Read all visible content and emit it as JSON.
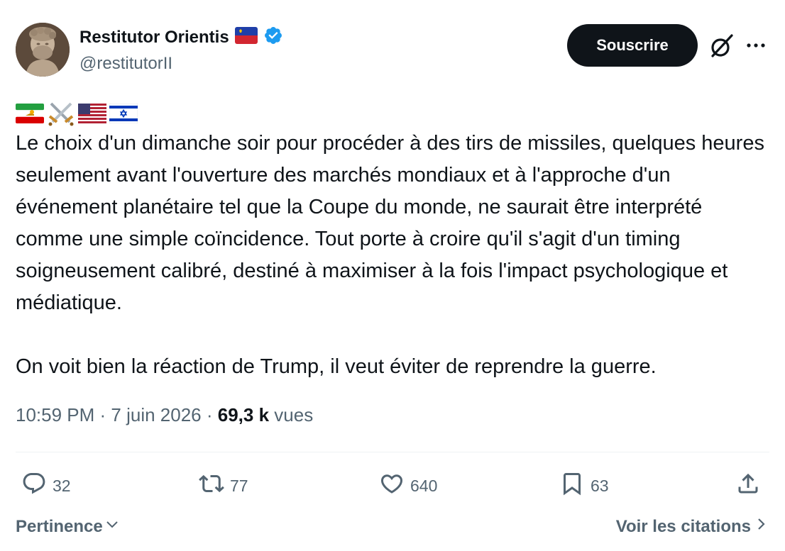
{
  "author": {
    "display_name": "Restitutor Orientis",
    "handle": "@restitutorII",
    "badge_flag": "liechtenstein-flag",
    "verified": true
  },
  "header": {
    "subscribe_label": "Souscrire",
    "grok_icon": "grok-icon",
    "more_icon": "more-icon"
  },
  "tweet": {
    "emoji": [
      "iran-lion-sun-flag",
      "crossed-swords",
      "us-flag",
      "israel-flag"
    ],
    "paragraphs": [
      "Le choix d'un dimanche soir pour procéder à des tirs de missiles, quelques heures seulement avant l'ouverture des marchés mondiaux et à l'approche d'un événement planétaire tel que la Coupe du monde, ne saurait être interprété comme une simple coïncidence. Tout porte à croire qu'il s'agit d'un timing soigneusement calibré, destiné à maximiser à la fois l'impact psychologique et médiatique.",
      "On voit bien la réaction de Trump, il veut éviter de reprendre la guerre."
    ]
  },
  "meta": {
    "time": "10:59 PM",
    "separator": " · ",
    "date": "7 juin 2026",
    "views_count": "69,3 k",
    "views_label": " vues"
  },
  "actions": {
    "replies": "32",
    "reposts": "77",
    "likes": "640",
    "bookmarks": "63"
  },
  "footer": {
    "sort_label": "Pertinence",
    "quotes_label": "Voir les citations"
  },
  "colors": {
    "text": "#0f1419",
    "secondary": "#536471",
    "verified_blue": "#1d9bf0",
    "button_bg": "#0f1419",
    "divider": "#eff3f4"
  }
}
